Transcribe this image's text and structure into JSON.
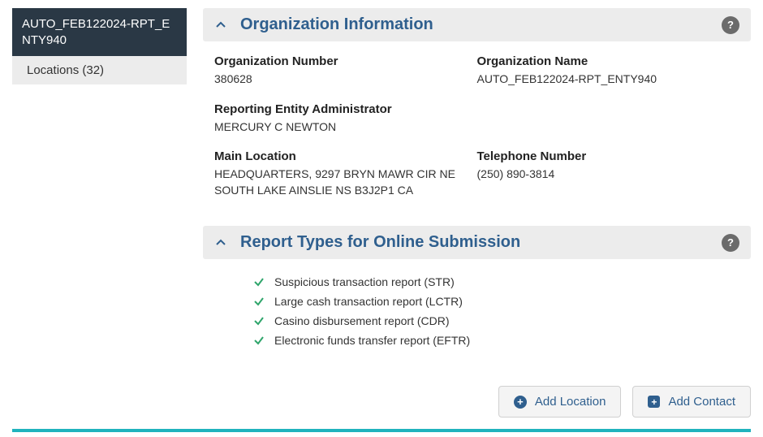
{
  "sidebar": {
    "title": "AUTO_FEB122024-RPT_ENTY940",
    "item": "Locations (32)"
  },
  "panels": {
    "org": {
      "title": "Organization Information",
      "fields": {
        "org_number_label": "Organization Number",
        "org_number_value": "380628",
        "org_name_label": "Organization Name",
        "org_name_value": "AUTO_FEB122024-RPT_ENTY940",
        "admin_label": "Reporting Entity Administrator",
        "admin_value": "MERCURY C NEWTON",
        "main_loc_label": "Main Location",
        "main_loc_value": "HEADQUARTERS, 9297 BRYN MAWR CIR NE SOUTH LAKE AINSLIE NS B3J2P1 CA",
        "tel_label": "Telephone Number",
        "tel_value": "(250) 890-3814"
      }
    },
    "reports": {
      "title": "Report Types for Online Submission",
      "items": [
        "Suspicious transaction report (STR)",
        "Large cash transaction report (LCTR)",
        "Casino disbursement report (CDR)",
        "Electronic funds transfer report (EFTR)"
      ]
    }
  },
  "actions": {
    "add_location": "Add Location",
    "add_contact": "Add Contact"
  },
  "help_glyph": "?"
}
